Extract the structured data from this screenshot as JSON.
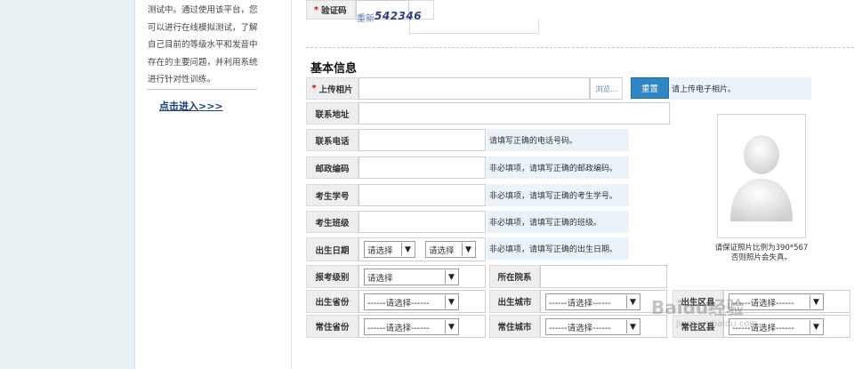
{
  "sidebar": {
    "description_lines": [
      "测试中。通过使用该平台，您",
      "可以进行在线模拟测试，了解",
      "自己目前的等级水平和发音中",
      "存在的主要问题，并利用系统",
      "进行针对性训练。"
    ],
    "enter_link": "点击进入>>>"
  },
  "captcha": {
    "label": "验证码",
    "refresh": "重新",
    "code": "542346"
  },
  "basic_info": {
    "title": "基本信息",
    "upload": {
      "label": "上传相片",
      "browse": "浏览...",
      "reset": "重置",
      "hint": "请上传电子相片。"
    },
    "address": {
      "label": "联系地址"
    },
    "phone": {
      "label": "联系电话",
      "hint": "请填写正确的电话号码。"
    },
    "postcode": {
      "label": "邮政编码",
      "hint": "非必填项，请填写正确的邮政编码。"
    },
    "student_id": {
      "label": "考生学号",
      "hint": "非必填项，请填写正确的考生学号。"
    },
    "class": {
      "label": "考生班级",
      "hint": "非必填项，请填写正确的班级。"
    },
    "birthdate": {
      "label": "出生日期",
      "select1": "请选择",
      "select2": "请选择",
      "hint": "非必填项，请填写正确的出生日期。"
    },
    "exam_level": {
      "label": "报考级别",
      "value": "请选择"
    },
    "department": {
      "label": "所在院系"
    },
    "birth_province": {
      "label": "出生省份",
      "value": "------请选择------"
    },
    "birth_city": {
      "label": "出生城市",
      "value": "------请选择------"
    },
    "birth_district": {
      "label": "出生区县",
      "value": "------请选择------"
    },
    "res_province": {
      "label": "常住省份",
      "value": "------请选择------"
    },
    "res_city": {
      "label": "常住城市",
      "value": "------请选择------"
    },
    "res_district": {
      "label": "常住区县",
      "value": "------请选择------"
    }
  },
  "photo": {
    "note_lines": [
      "请保证照片比例为390*567",
      "否则照片会失真。"
    ]
  },
  "watermark": {
    "brand": "Baidu经验",
    "url": "jingyan.baidu.com"
  }
}
